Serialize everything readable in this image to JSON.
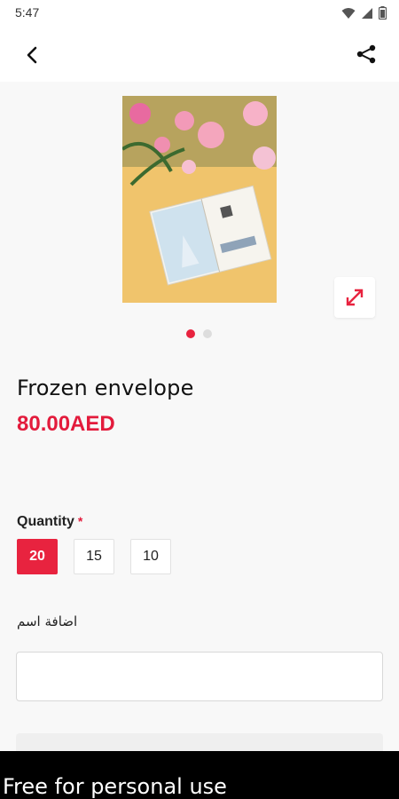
{
  "status_bar": {
    "time": "5:47",
    "icons": [
      "wifi-icon",
      "signal-icon",
      "battery-icon"
    ]
  },
  "app_bar": {
    "back_icon": "chevron-left-icon",
    "share_icon": "share-icon"
  },
  "product": {
    "image_pages": 2,
    "active_page": 1,
    "title": "Frozen envelope",
    "price": "80.00AED"
  },
  "quantity": {
    "label": "Quantity",
    "required_marker": "*",
    "options": [
      "20",
      "15",
      "10"
    ],
    "selected": "20"
  },
  "name_field": {
    "label": "اضافة اسم",
    "value": "",
    "placeholder": ""
  },
  "watermark": {
    "text": "Free for personal use"
  },
  "colors": {
    "accent": "#e8233f",
    "price": "#e31b3c",
    "background": "#f8f8f8"
  }
}
